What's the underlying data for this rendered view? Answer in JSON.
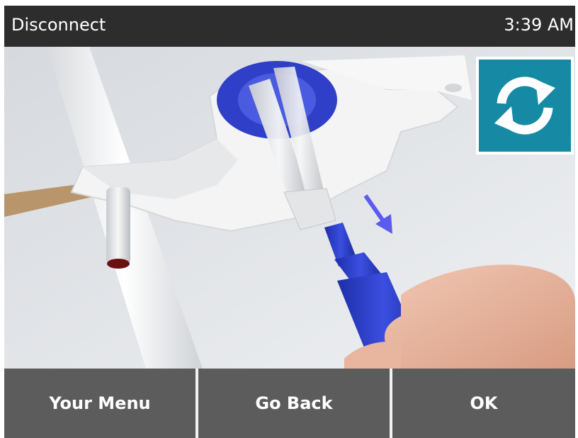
{
  "header": {
    "title": "Disconnect",
    "time": "3:39 AM"
  },
  "illustration": {
    "description_icon": "disconnect-tubing-illustration",
    "arrow_color": "#5b5bf0",
    "connector_color": "#2f3fc8"
  },
  "replay": {
    "icon": "replay-icon",
    "color": "#168aa4"
  },
  "footer": {
    "menu_label": "Your Menu",
    "back_label": "Go Back",
    "ok_label": "OK"
  }
}
